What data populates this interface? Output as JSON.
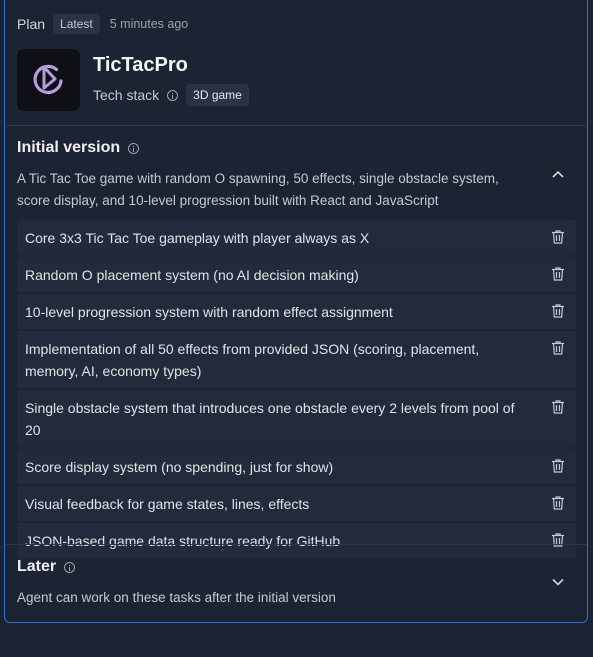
{
  "header": {
    "plan_label": "Plan",
    "badge": "Latest",
    "timestamp": "5 minutes ago"
  },
  "app": {
    "name": "TicTacPro",
    "stack_label": "Tech stack",
    "tech_badge": "3D game",
    "icon": "play-circle-logo-icon"
  },
  "initial": {
    "title": "Initial version",
    "description": "A Tic Tac Toe game with random O spawning, 50 effects, single obstacle system, score display, and 10-level progression built with React and JavaScript",
    "expanded": true,
    "tasks": [
      "Core 3x3 Tic Tac Toe gameplay with player always as X",
      "Random O placement system (no AI decision making)",
      "10-level progression system with random effect assignment",
      "Implementation of all 50 effects from provided JSON (scoring, placement, memory, AI, economy types)",
      "Single obstacle system that introduces one obstacle every 2 levels from pool of 20",
      "Score display system (no spending, just for show)",
      "Visual feedback for game states, lines, effects",
      "JSON-based game data structure ready for GitHub"
    ]
  },
  "later": {
    "title": "Later",
    "description": "Agent can work on these tasks after the initial version",
    "expanded": false
  },
  "colors": {
    "background": "#1c2333",
    "border_accent": "#2f6fd6",
    "task_bg": "#232a3b",
    "logo_accent": "#b39ddb"
  }
}
